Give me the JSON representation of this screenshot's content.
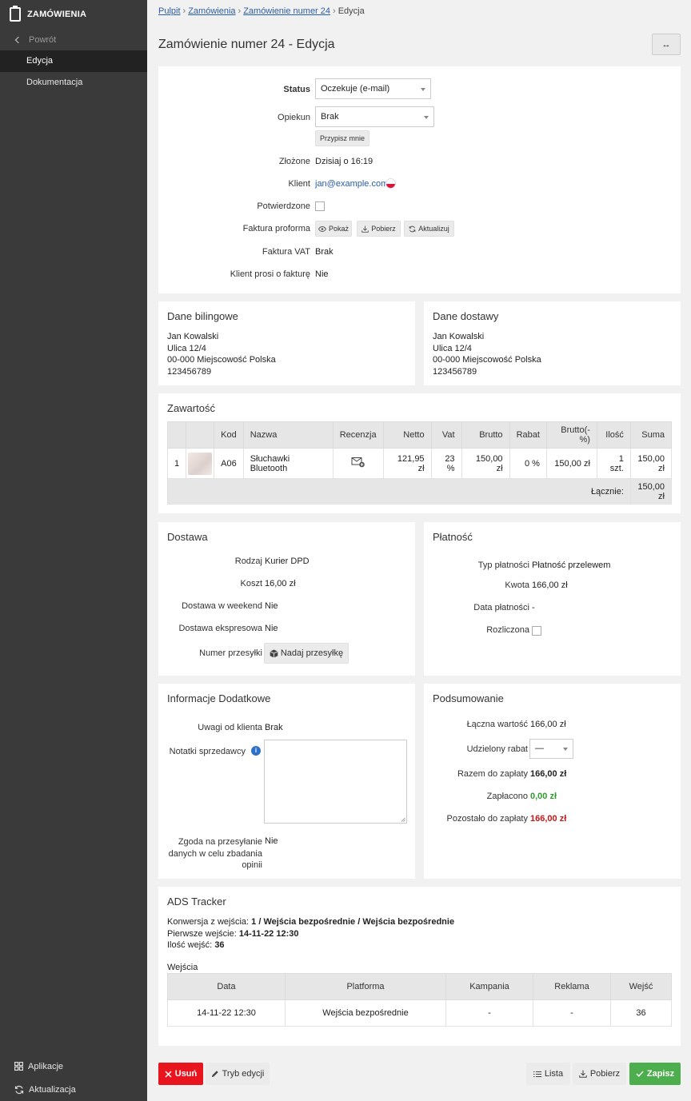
{
  "sidebar": {
    "title": "ZAMÓWIENIA",
    "back": "Powrót",
    "items": [
      {
        "label": "Edycja"
      },
      {
        "label": "Dokumentacja"
      }
    ],
    "bottom": [
      {
        "label": "Aplikacje"
      },
      {
        "label": "Aktualizacja"
      }
    ]
  },
  "breadcrumb": {
    "items": [
      "Pulpit",
      "Zamówienia",
      "Zamówienie numer 24"
    ],
    "current": "Edycja"
  },
  "page": {
    "title": "Zamówienie numer 24 - Edycja",
    "expand": "↔"
  },
  "order": {
    "status_label": "Status",
    "status_value": "Oczekuje (e-mail)",
    "guardian_label": "Opiekun",
    "guardian_value": "Brak",
    "assign_me": "Przypisz mnie",
    "placed_label": "Złożone",
    "placed_value": "Dzisiaj o 16:19",
    "client_label": "Klient",
    "client_value": "jan@example.com",
    "confirmed_label": "Potwierdzone",
    "proforma_label": "Faktura proforma",
    "proforma_show": "Pokaż",
    "proforma_download": "Pobierz",
    "proforma_update": "Aktualizuj",
    "vat_label": "Faktura VAT",
    "vat_value": "Brak",
    "wants_invoice_label": "Klient prosi o fakturę",
    "wants_invoice_value": "Nie"
  },
  "billing": {
    "title": "Dane bilingowe",
    "lines": [
      "Jan Kowalski",
      "Ulica 12/4",
      "00-000 Miejscowość Polska",
      "123456789"
    ]
  },
  "shipping": {
    "title": "Dane dostawy",
    "lines": [
      "Jan Kowalski",
      "Ulica 12/4",
      "00-000 Miejscowość Polska",
      "123456789"
    ]
  },
  "contents": {
    "title": "Zawartość",
    "headers": [
      "",
      "",
      "Kod",
      "Nazwa",
      "Recenzja",
      "Netto",
      "Vat",
      "Brutto",
      "Rabat",
      "Brutto(-%)",
      "Ilość",
      "Suma"
    ],
    "row": {
      "no": "1",
      "code": "A06",
      "name": "Słuchawki Bluetooth",
      "net": "121,95 zł",
      "vat": "23 %",
      "gross": "150,00 zł",
      "discount": "0 %",
      "gross_disc": "150,00 zł",
      "qty": "1 szt.",
      "sum": "150,00 zł"
    },
    "total_label": "Łącznie:",
    "total_value": "150,00 zł"
  },
  "delivery": {
    "title": "Dostawa",
    "type_label": "Rodzaj",
    "type_value": "Kurier DPD",
    "cost_label": "Koszt",
    "cost_value": "16,00 zł",
    "weekend_label": "Dostawa w weekend",
    "weekend_value": "Nie",
    "express_label": "Dostawa ekspresowa",
    "express_value": "Nie",
    "tracking_label": "Numer przesyłki",
    "tracking_button": "Nadaj przesyłkę"
  },
  "payment": {
    "title": "Płatność",
    "type_label": "Typ płatności",
    "type_value": "Płatność przelewem",
    "amount_label": "Kwota",
    "amount_value": "166,00 zł",
    "date_label": "Data płatności",
    "date_value": "-",
    "settled_label": "Rozliczona"
  },
  "extra": {
    "title": "Informacje Dodatkowe",
    "notes_client_label": "Uwagi od klienta",
    "notes_client_value": "Brak",
    "notes_seller_label": "Notatki sprzedawcy",
    "consent_label_1": "Zgoda na przesyłanie",
    "consent_label_2": "danych w celu zbadania",
    "consent_label_3": "opinii",
    "consent_value": "Nie"
  },
  "summary": {
    "title": "Podsumowanie",
    "total_label": "Łączna wartość",
    "total_value": "166,00 zł",
    "discount_label": "Udzielony rabat",
    "discount_value": "—",
    "topay_label": "Razem do zapłaty",
    "topay_value": "166,00 zł",
    "paid_label": "Zapłacono",
    "paid_value": "0,00 zł",
    "remaining_label": "Pozostało do zapłaty",
    "remaining_value": "166,00 zł",
    "colors": {
      "paid": "#2e9e2e",
      "remaining": "#c01818"
    }
  },
  "ads": {
    "title": "ADS Tracker",
    "conversion_label": "Konwersja z wejścia:",
    "conversion_value": "1 / Wejścia bezpośrednie / Wejścia bezpośrednie",
    "first_label": "Pierwsze wejście:",
    "first_value": "14-11-22 12:30",
    "count_label": "Ilość wejść:",
    "count_value": "36",
    "entries_title": "Wejścia",
    "headers": [
      "Data",
      "Platforma",
      "Kampania",
      "Reklama",
      "Wejść"
    ],
    "rows": [
      [
        "14-11-22 12:30",
        "Wejścia bezpośrednie",
        "-",
        "-",
        "36"
      ]
    ]
  },
  "actions": {
    "delete": "Usuń",
    "edit_mode": "Tryb edycji",
    "list": "Lista",
    "download": "Pobierz",
    "save": "Zapisz",
    "colors": {
      "delete": "#e8141e",
      "save": "#4cae4c"
    }
  }
}
